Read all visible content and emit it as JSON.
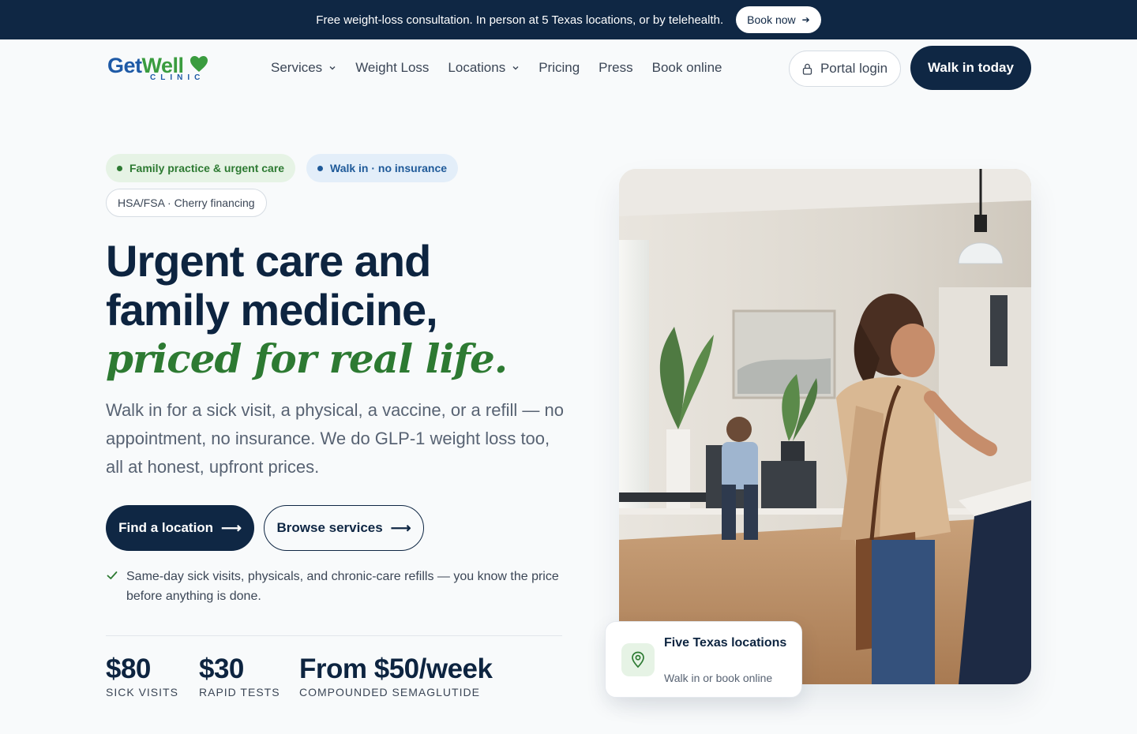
{
  "announcement": {
    "text": "Free weight-loss consultation. In person at 5 Texas locations, or by telehealth.",
    "button_label": "Book now"
  },
  "brand": {
    "logo_primary": "GetWell",
    "logo_secondary": "CLINIC",
    "navy": "#0f2744",
    "green": "#2d7a32",
    "blue": "#1e5aa6"
  },
  "nav": {
    "items": [
      {
        "label": "Services",
        "has_dropdown": true
      },
      {
        "label": "Weight Loss",
        "has_dropdown": false
      },
      {
        "label": "Locations",
        "has_dropdown": true
      },
      {
        "label": "Pricing",
        "has_dropdown": false
      },
      {
        "label": "Press",
        "has_dropdown": false
      },
      {
        "label": "Book online",
        "has_dropdown": false
      }
    ],
    "portal_label": "Portal login",
    "cta_label": "Walk in today"
  },
  "hero": {
    "tags": [
      "Family practice & urgent care",
      "Walk in · no insurance",
      "HSA/FSA · Cherry financing"
    ],
    "headline_line1": "Urgent care and",
    "headline_line2": "family medicine,",
    "headline_accent": "priced for real life.",
    "lead": "Walk in for a sick visit, a physical, a vaccine, or a refill — no appointment, no insurance. We do GLP-1 weight loss too, all at honest, upfront prices.",
    "primary_button": "Find a location",
    "secondary_button": "Browse services",
    "check_text": "Same-day sick visits, physicals, and chronic-care refills — you know the price before anything is done.",
    "stats": [
      {
        "value": "$80",
        "label": "SICK VISITS"
      },
      {
        "value": "$30",
        "label": "RAPID TESTS"
      },
      {
        "value": "From $50/week",
        "label": "COMPOUNDED SEMAGLUTIDE"
      }
    ]
  },
  "location_card": {
    "title": "Five Texas locations",
    "subtitle": "Walk in or book online"
  }
}
